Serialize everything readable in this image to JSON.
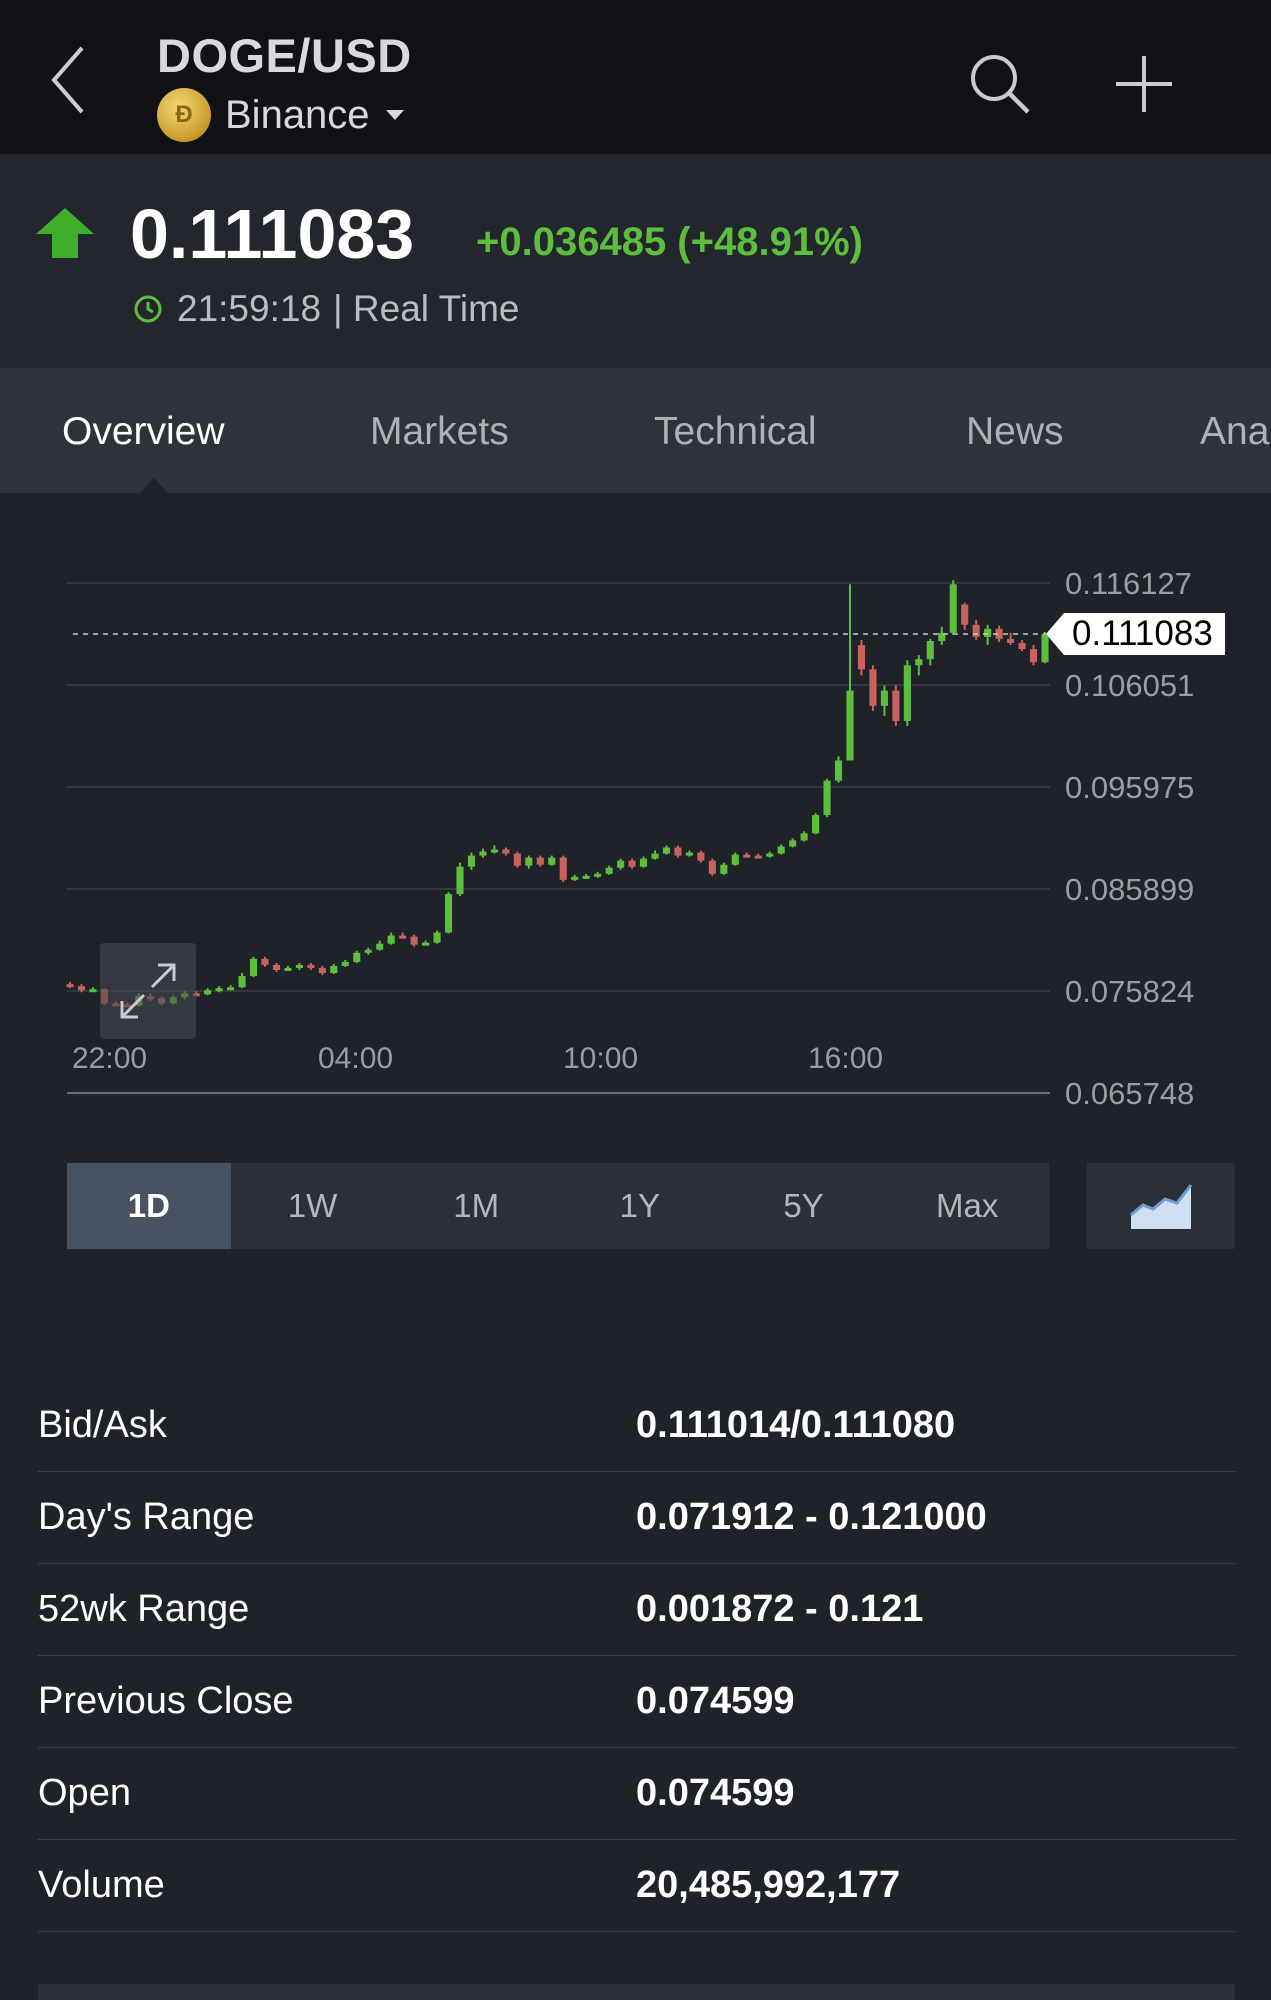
{
  "header": {
    "symbol": "DOGE/USD",
    "exchange": "Binance",
    "coin_icon": "dogecoin-icon",
    "coin_glyph": "Ð"
  },
  "quote": {
    "price": "0.111083",
    "change": "+0.036485 (+48.91%)",
    "time": "21:59:18",
    "status": "| Real Time",
    "direction": "up",
    "up_color": "#5cbe3c",
    "down_color": "#c8625e"
  },
  "tabs": [
    "Overview",
    "Markets",
    "Technical",
    "News",
    "Ana"
  ],
  "active_tab": 0,
  "chart_data": {
    "type": "candlestick",
    "y_ticks": [
      "0.116127",
      "0.106051",
      "0.095975",
      "0.085899",
      "0.075824",
      "0.065748"
    ],
    "x_ticks": [
      "22:00",
      "04:00",
      "10:00",
      "16:00"
    ],
    "ylim": [
      0.065748,
      0.116127
    ],
    "current_price": "0.111083",
    "candles": [
      {
        "o": 0.0765,
        "c": 0.0763,
        "h": 0.0767,
        "l": 0.0761
      },
      {
        "o": 0.0763,
        "c": 0.0759,
        "h": 0.0765,
        "l": 0.0757
      },
      {
        "o": 0.0759,
        "c": 0.076,
        "h": 0.0762,
        "l": 0.0758
      },
      {
        "o": 0.076,
        "c": 0.0746,
        "h": 0.0761,
        "l": 0.0744
      },
      {
        "o": 0.0746,
        "c": 0.0745,
        "h": 0.0748,
        "l": 0.0744
      },
      {
        "o": 0.0745,
        "c": 0.0744,
        "h": 0.0747,
        "l": 0.0743
      },
      {
        "o": 0.0744,
        "c": 0.0753,
        "h": 0.0756,
        "l": 0.0743
      },
      {
        "o": 0.0753,
        "c": 0.0751,
        "h": 0.0756,
        "l": 0.0748
      },
      {
        "o": 0.0751,
        "c": 0.0746,
        "h": 0.0753,
        "l": 0.0744
      },
      {
        "o": 0.0746,
        "c": 0.0752,
        "h": 0.0754,
        "l": 0.0745
      },
      {
        "o": 0.0752,
        "c": 0.0756,
        "h": 0.0758,
        "l": 0.075
      },
      {
        "o": 0.0756,
        "c": 0.0755,
        "h": 0.0758,
        "l": 0.0753
      },
      {
        "o": 0.0755,
        "c": 0.0759,
        "h": 0.0761,
        "l": 0.0754
      },
      {
        "o": 0.0759,
        "c": 0.0761,
        "h": 0.0763,
        "l": 0.0757
      },
      {
        "o": 0.0761,
        "c": 0.0762,
        "h": 0.0764,
        "l": 0.0759
      },
      {
        "o": 0.0762,
        "c": 0.0773,
        "h": 0.0776,
        "l": 0.0761
      },
      {
        "o": 0.0773,
        "c": 0.079,
        "h": 0.0792,
        "l": 0.0772
      },
      {
        "o": 0.079,
        "c": 0.0784,
        "h": 0.0792,
        "l": 0.0782
      },
      {
        "o": 0.0784,
        "c": 0.0779,
        "h": 0.0786,
        "l": 0.0777
      },
      {
        "o": 0.0779,
        "c": 0.0781,
        "h": 0.0783,
        "l": 0.0778
      },
      {
        "o": 0.0781,
        "c": 0.0784,
        "h": 0.0786,
        "l": 0.0779
      },
      {
        "o": 0.0784,
        "c": 0.0781,
        "h": 0.0786,
        "l": 0.0779
      },
      {
        "o": 0.0781,
        "c": 0.0776,
        "h": 0.0783,
        "l": 0.0774
      },
      {
        "o": 0.0776,
        "c": 0.0783,
        "h": 0.0785,
        "l": 0.0775
      },
      {
        "o": 0.0783,
        "c": 0.0787,
        "h": 0.0789,
        "l": 0.0782
      },
      {
        "o": 0.0787,
        "c": 0.0796,
        "h": 0.0798,
        "l": 0.0786
      },
      {
        "o": 0.0796,
        "c": 0.0799,
        "h": 0.0801,
        "l": 0.0794
      },
      {
        "o": 0.0799,
        "c": 0.0805,
        "h": 0.0808,
        "l": 0.0798
      },
      {
        "o": 0.0805,
        "c": 0.0813,
        "h": 0.0816,
        "l": 0.0804
      },
      {
        "o": 0.0813,
        "c": 0.0812,
        "h": 0.0816,
        "l": 0.081
      },
      {
        "o": 0.0812,
        "c": 0.0804,
        "h": 0.0814,
        "l": 0.0802
      },
      {
        "o": 0.0804,
        "c": 0.0806,
        "h": 0.0808,
        "l": 0.0803
      },
      {
        "o": 0.0806,
        "c": 0.0816,
        "h": 0.0818,
        "l": 0.0805
      },
      {
        "o": 0.0816,
        "c": 0.0854,
        "h": 0.0856,
        "l": 0.0815
      },
      {
        "o": 0.0854,
        "c": 0.0881,
        "h": 0.0885,
        "l": 0.0852
      },
      {
        "o": 0.0881,
        "c": 0.0892,
        "h": 0.0895,
        "l": 0.0878
      },
      {
        "o": 0.0892,
        "c": 0.0896,
        "h": 0.0899,
        "l": 0.089
      },
      {
        "o": 0.0896,
        "c": 0.0898,
        "h": 0.0902,
        "l": 0.0894
      },
      {
        "o": 0.0898,
        "c": 0.0894,
        "h": 0.09,
        "l": 0.0892
      },
      {
        "o": 0.0894,
        "c": 0.0882,
        "h": 0.0896,
        "l": 0.088
      },
      {
        "o": 0.0882,
        "c": 0.089,
        "h": 0.0892,
        "l": 0.0879
      },
      {
        "o": 0.089,
        "c": 0.0883,
        "h": 0.0892,
        "l": 0.0881
      },
      {
        "o": 0.0883,
        "c": 0.089,
        "h": 0.0892,
        "l": 0.0882
      },
      {
        "o": 0.089,
        "c": 0.0868,
        "h": 0.0892,
        "l": 0.0866
      },
      {
        "o": 0.0868,
        "c": 0.0871,
        "h": 0.0873,
        "l": 0.0867
      },
      {
        "o": 0.0871,
        "c": 0.0872,
        "h": 0.0874,
        "l": 0.0869
      },
      {
        "o": 0.0872,
        "c": 0.0874,
        "h": 0.0876,
        "l": 0.087
      },
      {
        "o": 0.0874,
        "c": 0.088,
        "h": 0.0882,
        "l": 0.0873
      },
      {
        "o": 0.088,
        "c": 0.0887,
        "h": 0.0889,
        "l": 0.0878
      },
      {
        "o": 0.0887,
        "c": 0.0881,
        "h": 0.0889,
        "l": 0.0879
      },
      {
        "o": 0.0881,
        "c": 0.0889,
        "h": 0.0891,
        "l": 0.088
      },
      {
        "o": 0.0889,
        "c": 0.0894,
        "h": 0.0897,
        "l": 0.0888
      },
      {
        "o": 0.0894,
        "c": 0.09,
        "h": 0.0902,
        "l": 0.0893
      },
      {
        "o": 0.09,
        "c": 0.0892,
        "h": 0.0902,
        "l": 0.089
      },
      {
        "o": 0.0892,
        "c": 0.0895,
        "h": 0.0897,
        "l": 0.0891
      },
      {
        "o": 0.0895,
        "c": 0.0887,
        "h": 0.0897,
        "l": 0.0885
      },
      {
        "o": 0.0887,
        "c": 0.0874,
        "h": 0.0889,
        "l": 0.0872
      },
      {
        "o": 0.0874,
        "c": 0.0883,
        "h": 0.0885,
        "l": 0.0873
      },
      {
        "o": 0.0883,
        "c": 0.0893,
        "h": 0.0895,
        "l": 0.0882
      },
      {
        "o": 0.0893,
        "c": 0.0892,
        "h": 0.0895,
        "l": 0.089
      },
      {
        "o": 0.0892,
        "c": 0.0891,
        "h": 0.0894,
        "l": 0.0889
      },
      {
        "o": 0.0891,
        "c": 0.0894,
        "h": 0.0896,
        "l": 0.089
      },
      {
        "o": 0.0894,
        "c": 0.0901,
        "h": 0.0903,
        "l": 0.0893
      },
      {
        "o": 0.0901,
        "c": 0.0907,
        "h": 0.0909,
        "l": 0.09
      },
      {
        "o": 0.0907,
        "c": 0.0914,
        "h": 0.0916,
        "l": 0.0906
      },
      {
        "o": 0.0914,
        "c": 0.0932,
        "h": 0.0934,
        "l": 0.0913
      },
      {
        "o": 0.0932,
        "c": 0.0966,
        "h": 0.0968,
        "l": 0.093
      },
      {
        "o": 0.0966,
        "c": 0.0986,
        "h": 0.099,
        "l": 0.0964
      },
      {
        "o": 0.0986,
        "c": 0.1055,
        "h": 0.116,
        "l": 0.105
      },
      {
        "o": 0.11,
        "c": 0.1076,
        "h": 0.1105,
        "l": 0.107
      },
      {
        "o": 0.1076,
        "c": 0.104,
        "h": 0.108,
        "l": 0.1035
      },
      {
        "o": 0.104,
        "c": 0.1055,
        "h": 0.106,
        "l": 0.103
      },
      {
        "o": 0.1055,
        "c": 0.1025,
        "h": 0.106,
        "l": 0.102
      },
      {
        "o": 0.1025,
        "c": 0.108,
        "h": 0.1085,
        "l": 0.102
      },
      {
        "o": 0.108,
        "c": 0.1086,
        "h": 0.109,
        "l": 0.107
      },
      {
        "o": 0.1086,
        "c": 0.1104,
        "h": 0.1106,
        "l": 0.108
      },
      {
        "o": 0.1104,
        "c": 0.1112,
        "h": 0.1118,
        "l": 0.11
      },
      {
        "o": 0.1112,
        "c": 0.116,
        "h": 0.1164,
        "l": 0.111
      },
      {
        "o": 0.114,
        "c": 0.112,
        "h": 0.1142,
        "l": 0.1115
      },
      {
        "o": 0.112,
        "c": 0.1108,
        "h": 0.1125,
        "l": 0.1105
      },
      {
        "o": 0.1108,
        "c": 0.1116,
        "h": 0.112,
        "l": 0.11
      },
      {
        "o": 0.1116,
        "c": 0.1106,
        "h": 0.1119,
        "l": 0.1103
      },
      {
        "o": 0.1106,
        "c": 0.1102,
        "h": 0.1112,
        "l": 0.11
      },
      {
        "o": 0.1102,
        "c": 0.1096,
        "h": 0.1105,
        "l": 0.1094
      },
      {
        "o": 0.1096,
        "c": 0.1083,
        "h": 0.11,
        "l": 0.108
      },
      {
        "o": 0.1083,
        "c": 0.11108,
        "h": 0.1113,
        "l": 0.1082
      }
    ]
  },
  "ranges": [
    "1D",
    "1W",
    "1M",
    "1Y",
    "5Y",
    "Max"
  ],
  "active_range": 0,
  "stats": [
    {
      "label": "Bid/Ask",
      "value": "0.111014/0.111080"
    },
    {
      "label": "Day's Range",
      "value": "0.071912 - 0.121000"
    },
    {
      "label": "52wk Range",
      "value": "0.001872 - 0.121"
    },
    {
      "label": "Previous Close",
      "value": "0.074599"
    },
    {
      "label": "Open",
      "value": "0.074599"
    },
    {
      "label": "Volume",
      "value": "20,485,992,177"
    }
  ]
}
